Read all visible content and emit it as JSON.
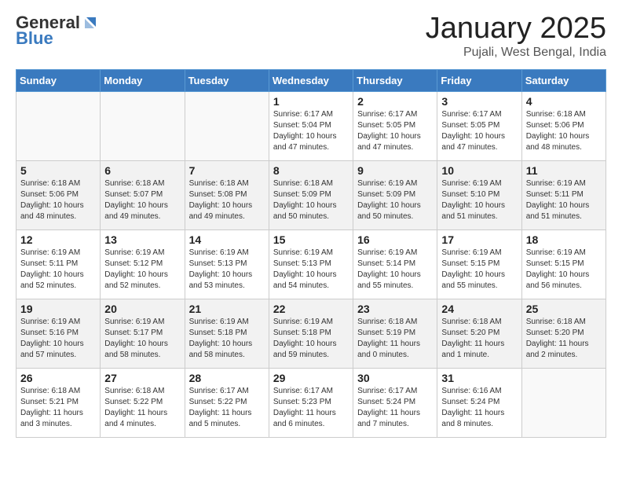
{
  "header": {
    "logo_general": "General",
    "logo_blue": "Blue",
    "title": "January 2025",
    "subtitle": "Pujali, West Bengal, India"
  },
  "weekdays": [
    "Sunday",
    "Monday",
    "Tuesday",
    "Wednesday",
    "Thursday",
    "Friday",
    "Saturday"
  ],
  "weeks": [
    [
      {
        "day": "",
        "info": ""
      },
      {
        "day": "",
        "info": ""
      },
      {
        "day": "",
        "info": ""
      },
      {
        "day": "1",
        "info": "Sunrise: 6:17 AM\nSunset: 5:04 PM\nDaylight: 10 hours and 47 minutes."
      },
      {
        "day": "2",
        "info": "Sunrise: 6:17 AM\nSunset: 5:05 PM\nDaylight: 10 hours and 47 minutes."
      },
      {
        "day": "3",
        "info": "Sunrise: 6:17 AM\nSunset: 5:05 PM\nDaylight: 10 hours and 47 minutes."
      },
      {
        "day": "4",
        "info": "Sunrise: 6:18 AM\nSunset: 5:06 PM\nDaylight: 10 hours and 48 minutes."
      }
    ],
    [
      {
        "day": "5",
        "info": "Sunrise: 6:18 AM\nSunset: 5:06 PM\nDaylight: 10 hours and 48 minutes."
      },
      {
        "day": "6",
        "info": "Sunrise: 6:18 AM\nSunset: 5:07 PM\nDaylight: 10 hours and 49 minutes."
      },
      {
        "day": "7",
        "info": "Sunrise: 6:18 AM\nSunset: 5:08 PM\nDaylight: 10 hours and 49 minutes."
      },
      {
        "day": "8",
        "info": "Sunrise: 6:18 AM\nSunset: 5:09 PM\nDaylight: 10 hours and 50 minutes."
      },
      {
        "day": "9",
        "info": "Sunrise: 6:19 AM\nSunset: 5:09 PM\nDaylight: 10 hours and 50 minutes."
      },
      {
        "day": "10",
        "info": "Sunrise: 6:19 AM\nSunset: 5:10 PM\nDaylight: 10 hours and 51 minutes."
      },
      {
        "day": "11",
        "info": "Sunrise: 6:19 AM\nSunset: 5:11 PM\nDaylight: 10 hours and 51 minutes."
      }
    ],
    [
      {
        "day": "12",
        "info": "Sunrise: 6:19 AM\nSunset: 5:11 PM\nDaylight: 10 hours and 52 minutes."
      },
      {
        "day": "13",
        "info": "Sunrise: 6:19 AM\nSunset: 5:12 PM\nDaylight: 10 hours and 52 minutes."
      },
      {
        "day": "14",
        "info": "Sunrise: 6:19 AM\nSunset: 5:13 PM\nDaylight: 10 hours and 53 minutes."
      },
      {
        "day": "15",
        "info": "Sunrise: 6:19 AM\nSunset: 5:13 PM\nDaylight: 10 hours and 54 minutes."
      },
      {
        "day": "16",
        "info": "Sunrise: 6:19 AM\nSunset: 5:14 PM\nDaylight: 10 hours and 55 minutes."
      },
      {
        "day": "17",
        "info": "Sunrise: 6:19 AM\nSunset: 5:15 PM\nDaylight: 10 hours and 55 minutes."
      },
      {
        "day": "18",
        "info": "Sunrise: 6:19 AM\nSunset: 5:15 PM\nDaylight: 10 hours and 56 minutes."
      }
    ],
    [
      {
        "day": "19",
        "info": "Sunrise: 6:19 AM\nSunset: 5:16 PM\nDaylight: 10 hours and 57 minutes."
      },
      {
        "day": "20",
        "info": "Sunrise: 6:19 AM\nSunset: 5:17 PM\nDaylight: 10 hours and 58 minutes."
      },
      {
        "day": "21",
        "info": "Sunrise: 6:19 AM\nSunset: 5:18 PM\nDaylight: 10 hours and 58 minutes."
      },
      {
        "day": "22",
        "info": "Sunrise: 6:19 AM\nSunset: 5:18 PM\nDaylight: 10 hours and 59 minutes."
      },
      {
        "day": "23",
        "info": "Sunrise: 6:18 AM\nSunset: 5:19 PM\nDaylight: 11 hours and 0 minutes."
      },
      {
        "day": "24",
        "info": "Sunrise: 6:18 AM\nSunset: 5:20 PM\nDaylight: 11 hours and 1 minute."
      },
      {
        "day": "25",
        "info": "Sunrise: 6:18 AM\nSunset: 5:20 PM\nDaylight: 11 hours and 2 minutes."
      }
    ],
    [
      {
        "day": "26",
        "info": "Sunrise: 6:18 AM\nSunset: 5:21 PM\nDaylight: 11 hours and 3 minutes."
      },
      {
        "day": "27",
        "info": "Sunrise: 6:18 AM\nSunset: 5:22 PM\nDaylight: 11 hours and 4 minutes."
      },
      {
        "day": "28",
        "info": "Sunrise: 6:17 AM\nSunset: 5:22 PM\nDaylight: 11 hours and 5 minutes."
      },
      {
        "day": "29",
        "info": "Sunrise: 6:17 AM\nSunset: 5:23 PM\nDaylight: 11 hours and 6 minutes."
      },
      {
        "day": "30",
        "info": "Sunrise: 6:17 AM\nSunset: 5:24 PM\nDaylight: 11 hours and 7 minutes."
      },
      {
        "day": "31",
        "info": "Sunrise: 6:16 AM\nSunset: 5:24 PM\nDaylight: 11 hours and 8 minutes."
      },
      {
        "day": "",
        "info": ""
      }
    ]
  ]
}
